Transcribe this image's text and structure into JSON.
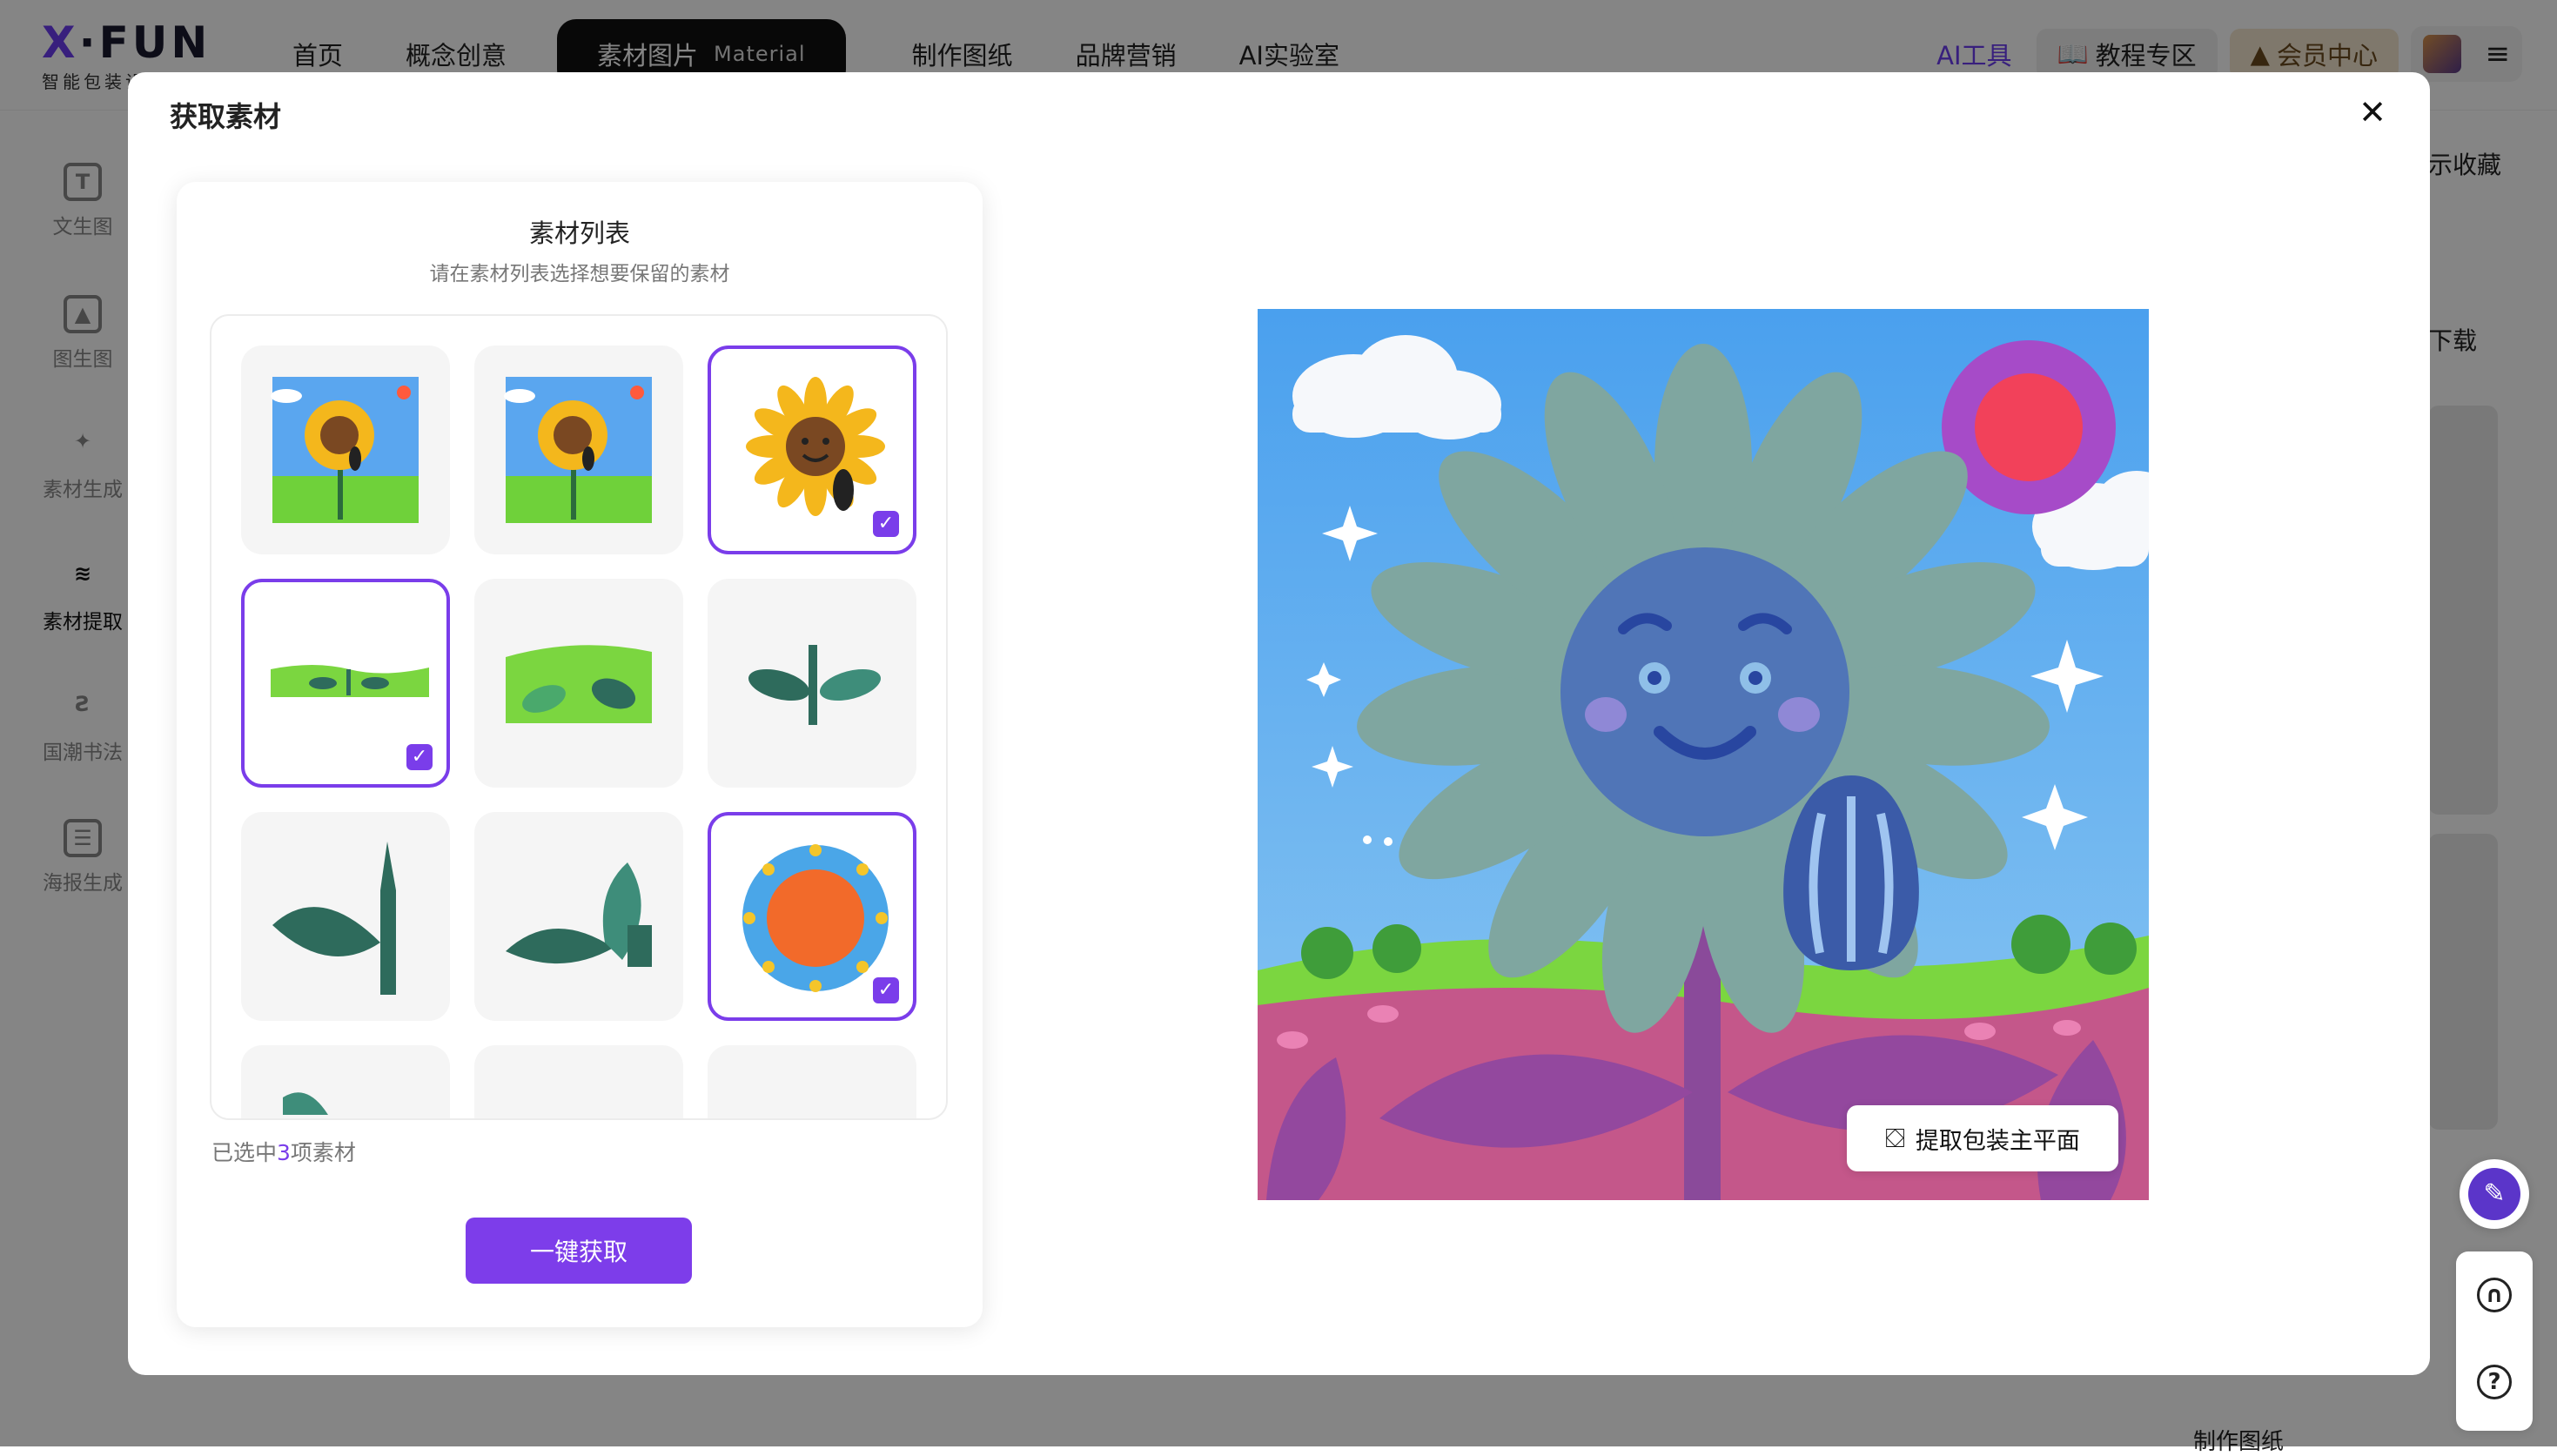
{
  "app": {
    "logo": {
      "x": "X",
      "dot": "·",
      "fun": "FUN",
      "sub": "智能包装设计平台"
    },
    "nav": [
      {
        "label": "首页"
      },
      {
        "label": "概念创意"
      },
      {
        "label": "素材图片",
        "en": "Material"
      },
      {
        "label": "制作图纸"
      },
      {
        "label": "品牌营销"
      },
      {
        "label": "AI实验室"
      }
    ],
    "right": {
      "ai_tools": "AI工具",
      "tutorials": "教程专区",
      "member": "会员中心"
    }
  },
  "sidebar": {
    "items": [
      {
        "label": "文生图",
        "icon": "text-image-icon",
        "glyph": "T"
      },
      {
        "label": "图生图",
        "icon": "image-to-image-icon",
        "glyph": "▲"
      },
      {
        "label": "素材生成",
        "icon": "sparkle-icon",
        "glyph": "✦"
      },
      {
        "label": "素材提取",
        "icon": "layers-icon",
        "glyph": "≋"
      },
      {
        "label": "国潮书法",
        "icon": "calligraphy-icon",
        "glyph": "Ƨ"
      },
      {
        "label": "海报生成",
        "icon": "poster-icon",
        "glyph": "☰"
      }
    ]
  },
  "background": {
    "show_favorites": "示收藏",
    "download": "下载",
    "bottom_text": "制作图纸"
  },
  "modal": {
    "title": "获取素材",
    "panel_title": "素材列表",
    "panel_subtitle": "请在素材列表选择想要保留的素材",
    "selected_prefix": "已选中",
    "selected_count": "3",
    "selected_suffix": "项素材",
    "get_button": "一键获取",
    "extract_button": "提取包装主平面",
    "tiles": [
      {
        "name": "full-scene",
        "selected": false
      },
      {
        "name": "full-scene-copy",
        "selected": false
      },
      {
        "name": "sunflower-face",
        "selected": true
      },
      {
        "name": "grass-strip",
        "selected": true
      },
      {
        "name": "grass-field",
        "selected": false
      },
      {
        "name": "stem-leaves",
        "selected": false
      },
      {
        "name": "stem-leaf-large",
        "selected": false
      },
      {
        "name": "leaves-pair",
        "selected": false
      },
      {
        "name": "sun",
        "selected": true
      },
      {
        "name": "partial-leaf",
        "selected": false
      },
      {
        "name": "partial-empty-1",
        "selected": false
      },
      {
        "name": "partial-empty-2",
        "selected": false
      }
    ]
  },
  "colors": {
    "accent": "#7a3dea",
    "sky": "#5ba5f0",
    "ground": "#c4578a",
    "petal": "#7fa6a0"
  }
}
